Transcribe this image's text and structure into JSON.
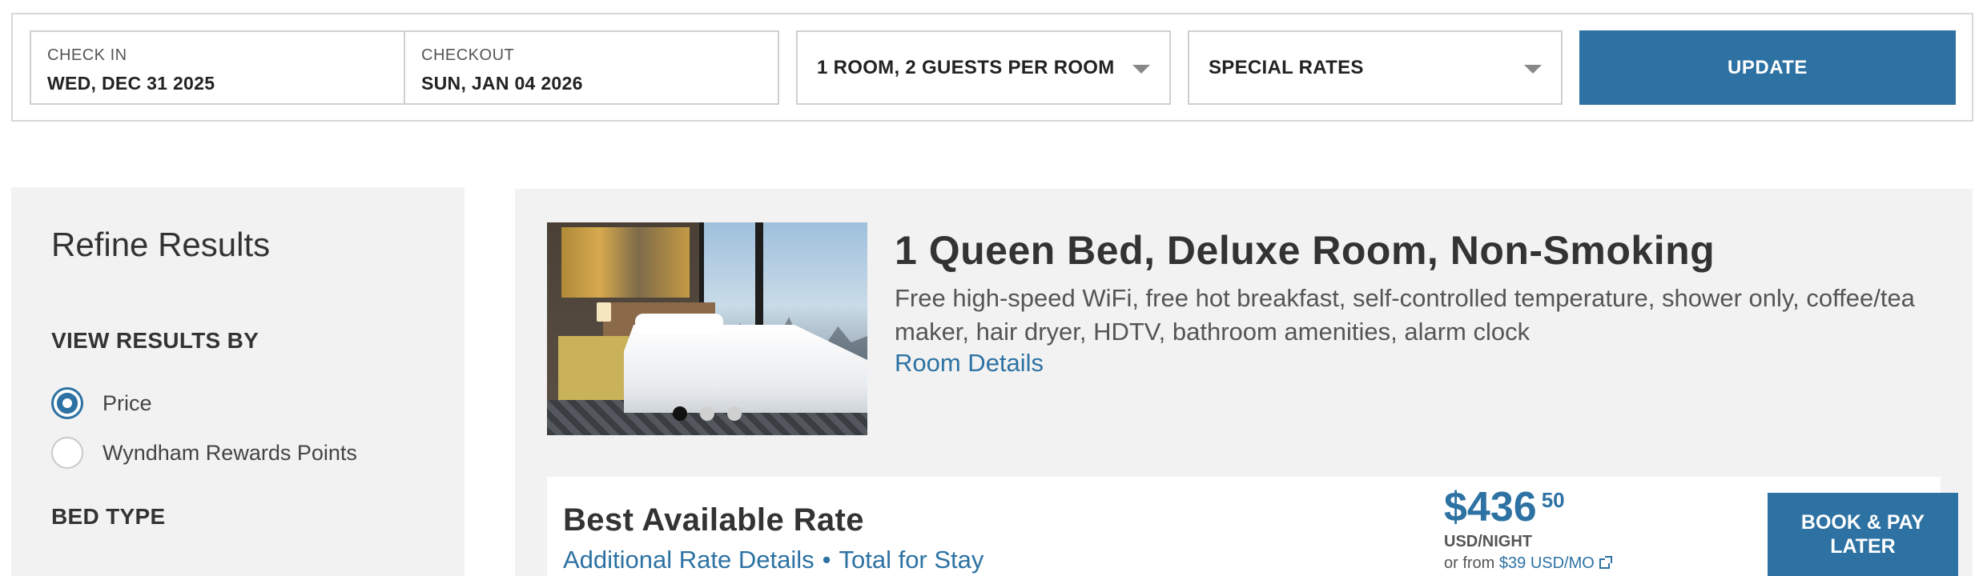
{
  "search": {
    "check_in_label": "CHECK IN",
    "check_in_value": "WED, DEC 31 2025",
    "checkout_label": "CHECKOUT",
    "checkout_value": "SUN, JAN 04 2026",
    "rooms_guests": "1 ROOM, 2 GUESTS PER ROOM",
    "special_rates": "SPECIAL RATES",
    "update_label": "UPDATE"
  },
  "sidebar": {
    "title": "Refine Results",
    "view_results_heading": "VIEW RESULTS BY",
    "options": [
      {
        "label": "Price",
        "selected": true
      },
      {
        "label": "Wyndham Rewards Points",
        "selected": false
      }
    ],
    "bed_type_heading": "BED TYPE"
  },
  "room": {
    "title": "1 Queen Bed, Deluxe Room, Non-Smoking",
    "amenities": "Free high-speed WiFi, free hot breakfast, self-controlled temperature, shower only, coffee/tea maker, hair dryer, HDTV, bathroom amenities, alarm clock",
    "details_link": "Room Details",
    "carousel": {
      "slide_count": 3,
      "active_index": 0
    }
  },
  "rate": {
    "name": "Best Available Rate",
    "additional_details_link": "Additional Rate Details",
    "separator": "•",
    "total_link": "Total for Stay",
    "price_dollars": "$436",
    "price_cents": "50",
    "price_unit": "USD/NIGHT",
    "financing_prefix": "or from",
    "financing_link": "$39 USD/MO",
    "book_label_line1": "BOOK & PAY",
    "book_label_line2": "LATER"
  },
  "colors": {
    "accent": "#2d72a3",
    "panel_bg": "#f2f2f2"
  },
  "icons": {
    "dropdown": "chevron-down-icon",
    "external_link": "external-link-icon"
  }
}
